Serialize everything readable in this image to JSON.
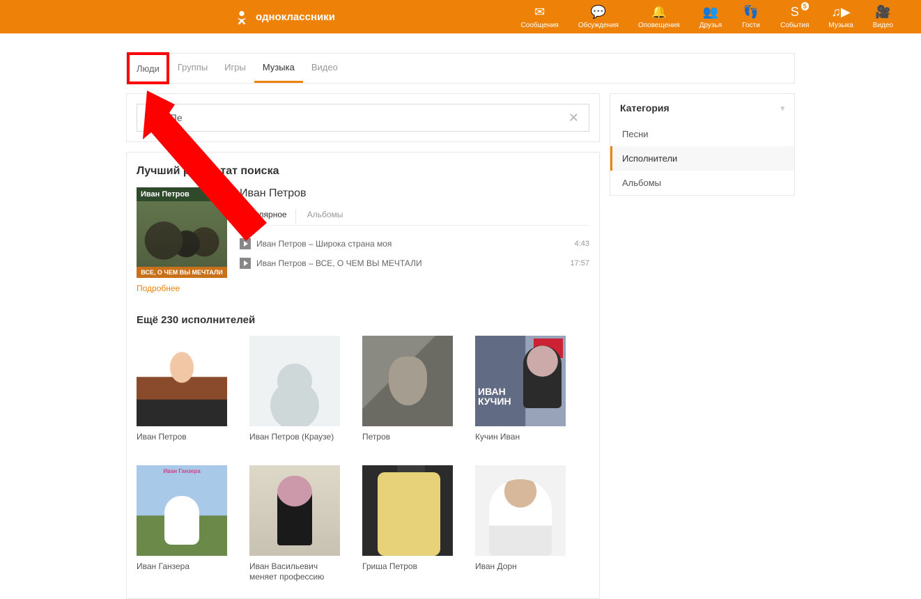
{
  "brand": "одноклассники",
  "top_nav": [
    {
      "label": "Сообщения",
      "icon": "mail-icon"
    },
    {
      "label": "Обсуждения",
      "icon": "chat-icon"
    },
    {
      "label": "Оповещения",
      "icon": "bell-icon"
    },
    {
      "label": "Друзья",
      "icon": "friends-icon"
    },
    {
      "label": "Гости",
      "icon": "guests-icon"
    },
    {
      "label": "События",
      "icon": "events-icon",
      "badge": "5"
    },
    {
      "label": "Музыка",
      "icon": "music-play-icon"
    },
    {
      "label": "Видео",
      "icon": "video-icon"
    }
  ],
  "nav_icons": {
    "mail-icon": "✉",
    "chat-icon": "💬",
    "bell-icon": "🔔",
    "friends-icon": "👥",
    "guests-icon": "👣",
    "events-icon": "S",
    "music-play-icon": "♫▶",
    "video-icon": "🎥"
  },
  "tabs": {
    "people": "Люди",
    "groups": "Группы",
    "games": "Игры",
    "music": "Музыка",
    "video": "Видео"
  },
  "search": {
    "value": "Иван Пe"
  },
  "best": {
    "heading": "Лучший результат поиска",
    "album_top": "Иван Петров",
    "album_bottom": "ВСЕ, О ЧЕМ ВЫ МЕЧТАЛИ",
    "more": "Подробнее",
    "artist": "Иван Петров",
    "subtabs": {
      "popular": "Популярное",
      "albums": "Альбомы"
    },
    "tracks": [
      {
        "title": "Иван Петров – Широка страна моя",
        "duration": "4:43"
      },
      {
        "title": "Иван Петров – ВСЕ, О ЧЕМ ВЫ МЕЧТАЛИ",
        "duration": "17:57"
      }
    ]
  },
  "more_artists": {
    "heading": "Ещё 230 исполнителей",
    "items": [
      {
        "name": "Иван Петров"
      },
      {
        "name": "Иван Петров (Краузе)"
      },
      {
        "name": "Петров"
      },
      {
        "name": "Кучин Иван"
      },
      {
        "name": "Иван Ганзера"
      },
      {
        "name": "Иван Васильевич меняет профессию"
      },
      {
        "name": "Гриша Петров"
      },
      {
        "name": "Иван Дорн"
      }
    ]
  },
  "sidebar": {
    "heading": "Категория",
    "cats": {
      "songs": "Песни",
      "artists": "Исполнители",
      "albums": "Альбомы"
    }
  }
}
